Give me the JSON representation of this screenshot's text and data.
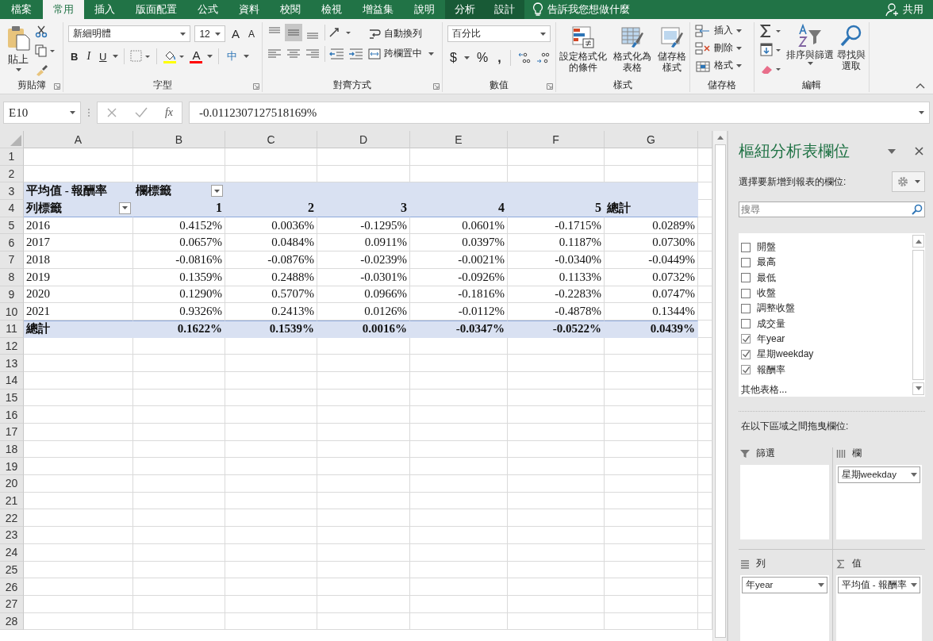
{
  "ribbon": {
    "tabs": [
      {
        "label": "檔案",
        "kind": "file",
        "selected": false
      },
      {
        "label": "常用",
        "kind": "standard",
        "selected": true
      },
      {
        "label": "插入",
        "kind": "standard",
        "selected": false
      },
      {
        "label": "版面配置",
        "kind": "standard",
        "selected": false
      },
      {
        "label": "公式",
        "kind": "standard",
        "selected": false
      },
      {
        "label": "資料",
        "kind": "standard",
        "selected": false
      },
      {
        "label": "校閱",
        "kind": "standard",
        "selected": false
      },
      {
        "label": "檢視",
        "kind": "standard",
        "selected": false
      },
      {
        "label": "增益集",
        "kind": "standard",
        "selected": false
      },
      {
        "label": "說明",
        "kind": "standard",
        "selected": false
      },
      {
        "label": "分析",
        "kind": "contextual",
        "selected": false
      },
      {
        "label": "設計",
        "kind": "contextual",
        "selected": false
      }
    ],
    "tell_me": "告訴我您想做什麼",
    "share": "共用",
    "clipboard": {
      "paste": "貼上",
      "label": "剪貼簿"
    },
    "font": {
      "name": "新細明體",
      "size": "12",
      "grow": "A",
      "shrink": "A",
      "bold": "B",
      "italic": "I",
      "underline": "U",
      "font_color": "A",
      "phonetic": "中",
      "label": "字型"
    },
    "alignment": {
      "wrap": "自動換列",
      "merge": "跨欄置中",
      "label": "對齊方式"
    },
    "number": {
      "format": "百分比",
      "currency": "$",
      "percent": "%",
      "comma": ",",
      "label": "數值"
    },
    "styles": {
      "items": [
        {
          "lines": [
            "設定格式化",
            "的條件"
          ],
          "kind": "conditional"
        },
        {
          "lines": [
            "格式化為",
            "表格"
          ],
          "kind": "table"
        },
        {
          "lines": [
            "儲存格",
            "樣式"
          ],
          "kind": "cellstyle"
        }
      ],
      "label": "樣式"
    },
    "cells": {
      "items": [
        {
          "label": "插入",
          "kind": "insert"
        },
        {
          "label": "刪除",
          "kind": "delete"
        },
        {
          "label": "格式",
          "kind": "format"
        }
      ],
      "label": "儲存格"
    },
    "editing": {
      "sort": "排序與篩選",
      "find": [
        "尋找與",
        "選取"
      ],
      "label": "編輯"
    }
  },
  "formula_bar": {
    "name_box": "E10",
    "function_label": "fx",
    "formula": "-0.0112307127518169%"
  },
  "sheet": {
    "columns": [
      "A",
      "B",
      "C",
      "D",
      "E",
      "F",
      "G"
    ],
    "row_numbers": [
      "1",
      "2",
      "3",
      "4",
      "5",
      "6",
      "7",
      "8",
      "9",
      "10",
      "11",
      "12",
      "13",
      "14",
      "15",
      "16",
      "17",
      "18",
      "19",
      "20",
      "21",
      "22",
      "23",
      "24",
      "25",
      "26",
      "27",
      "28"
    ]
  },
  "pivot": {
    "value_label": "平均值 - 報酬率",
    "column_label": "欄標籤",
    "row_label": "列標籤",
    "column_headers": [
      "1",
      "2",
      "3",
      "4",
      "5"
    ],
    "total_header": "總計",
    "rows": [
      {
        "label": "2016",
        "values": [
          "0.4152%",
          "0.0036%",
          "-0.1295%",
          "0.0601%",
          "-0.1715%",
          "0.0289%"
        ]
      },
      {
        "label": "2017",
        "values": [
          "0.0657%",
          "0.0484%",
          "0.0911%",
          "0.0397%",
          "0.1187%",
          "0.0730%"
        ]
      },
      {
        "label": "2018",
        "values": [
          "-0.0816%",
          "-0.0876%",
          "-0.0239%",
          "-0.0021%",
          "-0.0340%",
          "-0.0449%"
        ]
      },
      {
        "label": "2019",
        "values": [
          "0.1359%",
          "0.2488%",
          "-0.0301%",
          "-0.0926%",
          "0.1133%",
          "0.0732%"
        ]
      },
      {
        "label": "2020",
        "values": [
          "0.1290%",
          "0.5707%",
          "0.0966%",
          "-0.1816%",
          "-0.2283%",
          "0.0747%"
        ]
      },
      {
        "label": "2021",
        "values": [
          "0.9326%",
          "0.2413%",
          "0.0126%",
          "-0.0112%",
          "-0.4878%",
          "0.1344%"
        ]
      }
    ],
    "total": {
      "label": "總計",
      "values": [
        "0.1622%",
        "0.1539%",
        "0.0016%",
        "-0.0347%",
        "-0.0522%",
        "0.0439%"
      ]
    }
  },
  "pivot_fields": {
    "title": "樞紐分析表欄位",
    "choose_label": "選擇要新增到報表的欄位:",
    "search_placeholder": "搜尋",
    "fields": [
      {
        "label": "開盤",
        "checked": false
      },
      {
        "label": "最高",
        "checked": false
      },
      {
        "label": "最低",
        "checked": false
      },
      {
        "label": "收盤",
        "checked": false
      },
      {
        "label": "調整收盤",
        "checked": false
      },
      {
        "label": "成交量",
        "checked": false
      },
      {
        "label": "年year",
        "checked": true
      },
      {
        "label": "星期weekday",
        "checked": true
      },
      {
        "label": "報酬率",
        "checked": true
      }
    ],
    "more_tables": "其他表格...",
    "drag_label": "在以下區域之間拖曳欄位:",
    "areas": [
      {
        "kind": "filters",
        "title": "篩選"
      },
      {
        "kind": "columns",
        "title": "欄",
        "items": [
          "星期weekday"
        ]
      },
      {
        "kind": "rows",
        "title": "列",
        "items": [
          "年year"
        ]
      },
      {
        "kind": "values",
        "title": "值",
        "items": [
          "平均值 - 報酬率"
        ]
      }
    ]
  }
}
